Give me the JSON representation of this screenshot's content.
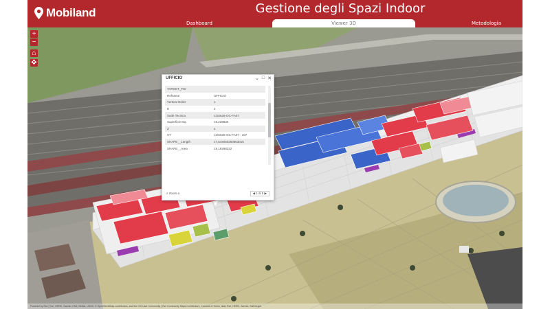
{
  "app": {
    "logo_text": "Mobiland",
    "title": "Gestione degli Spazi Indoor"
  },
  "tabs": [
    {
      "label": "Dashboard",
      "active": false
    },
    {
      "label": "Viewer 3D",
      "active": true
    },
    {
      "label": "Metodologia",
      "active": false
    }
  ],
  "colors": {
    "header": "#b3282d",
    "office_red": "#e23b4a",
    "office_blue": "#3a64c8",
    "service_yellow": "#d9d43a",
    "service_purple": "#9b3bb0"
  },
  "map_controls": {
    "zoom_in": "+",
    "zoom_out": "−",
    "home": "⌂",
    "compass": "✥"
  },
  "popup": {
    "title": "UFFICIO",
    "controls": [
      "⌄",
      "□",
      "✕"
    ],
    "attributes": [
      {
        "key": "TARGET_FID",
        "value": ""
      },
      {
        "key": "Refname",
        "value": "UFFICIO"
      },
      {
        "key": "Vertical Order",
        "value": "1"
      },
      {
        "key": "H",
        "value": "4"
      },
      {
        "key": "Sede Tecnica",
        "value": "LOS626-OC-FA07"
      },
      {
        "key": "Superficie Mq",
        "value": "19,229830"
      },
      {
        "key": "Z",
        "value": "4"
      },
      {
        "key": "ST",
        "value": "LOS626-OC-FA07 - 107"
      },
      {
        "key": "SHAPE__Length",
        "value": "17,544050260863015"
      },
      {
        "key": "SHAPE__Area",
        "value": "19,19298322"
      }
    ],
    "zoom_label": "Zoom a",
    "pager": "◀ 1 di 5 ▶"
  },
  "attribution": "Powered by Esri | Esri, HERE, Garmin, FAO, NOAA, USGS, © OpenStreetMap contributors, and the GIS User Community | Esri Community Maps Contributors, Comune di Torino, Istat, Esri, HERE, Garmin, SafeGraph"
}
